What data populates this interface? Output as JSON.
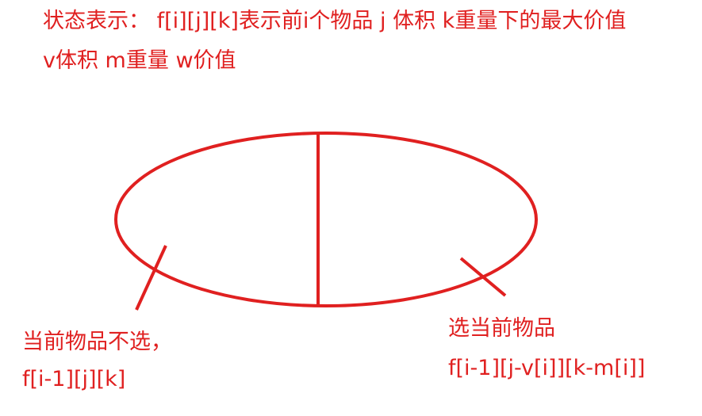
{
  "header": {
    "state_line": "状态表示： f[i][j][k]表示前i个物品 j 体积 k重量下的最大价值",
    "legend_line": "v体积  m重量  w价值"
  },
  "left_branch": {
    "title": "当前物品不选，",
    "formula": "f[i-1][j][k]"
  },
  "right_branch": {
    "title": "选当前物品",
    "formula": "f[i-1][j-v[i]][k-m[i]]"
  },
  "colors": {
    "ink": "#e02020"
  }
}
